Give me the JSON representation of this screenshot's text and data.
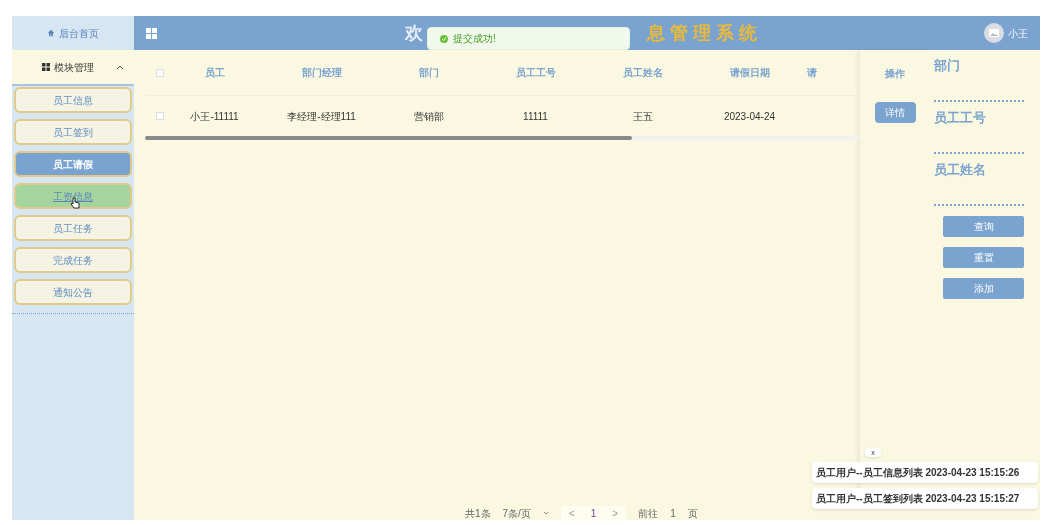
{
  "sidebar": {
    "home": "后台首页",
    "group": {
      "label": "模块管理",
      "expanded": true
    },
    "items": [
      {
        "label": "员工信息",
        "selected": false,
        "hovered": false
      },
      {
        "label": "员工签到",
        "selected": false,
        "hovered": false
      },
      {
        "label": "员工请假",
        "selected": true,
        "hovered": false
      },
      {
        "label": "工资信息",
        "selected": false,
        "hovered": true
      },
      {
        "label": "员工任务",
        "selected": false,
        "hovered": false
      },
      {
        "label": "完成任务",
        "selected": false,
        "hovered": false
      },
      {
        "label": "通知公告",
        "selected": false,
        "hovered": false
      }
    ]
  },
  "header": {
    "title_parts": [
      "欢",
      "息 管 理 系 统"
    ],
    "user": "小王"
  },
  "toast": {
    "message": "提交成功!"
  },
  "table": {
    "all_checked": false,
    "columns": [
      "员工",
      "部门经理",
      "部门",
      "员工工号",
      "员工姓名",
      "请假日期",
      "请"
    ],
    "action_column": "操作",
    "rows": [
      {
        "checked": false,
        "cells": [
          "小王-11111",
          "李经理-经理111",
          "营销部",
          "11111",
          "王五",
          "2023-04-24"
        ],
        "action": "详情"
      }
    ]
  },
  "filter": {
    "fields": [
      "部门",
      "员工工号",
      "员工姓名"
    ],
    "buttons": [
      "查询",
      "重置",
      "添加"
    ]
  },
  "pagination": {
    "total": "共1条",
    "page_size": "7条/页",
    "prev": "<",
    "page": "1",
    "next": ">",
    "goto": "前往",
    "goto_value": "1",
    "page_unit": "页"
  },
  "history": {
    "close": "x",
    "entries": [
      "员工用户--员工信息列表 2023-04-23 15:15:26",
      "员工用户--员工签到列表 2023-04-23 15:15:27"
    ]
  }
}
